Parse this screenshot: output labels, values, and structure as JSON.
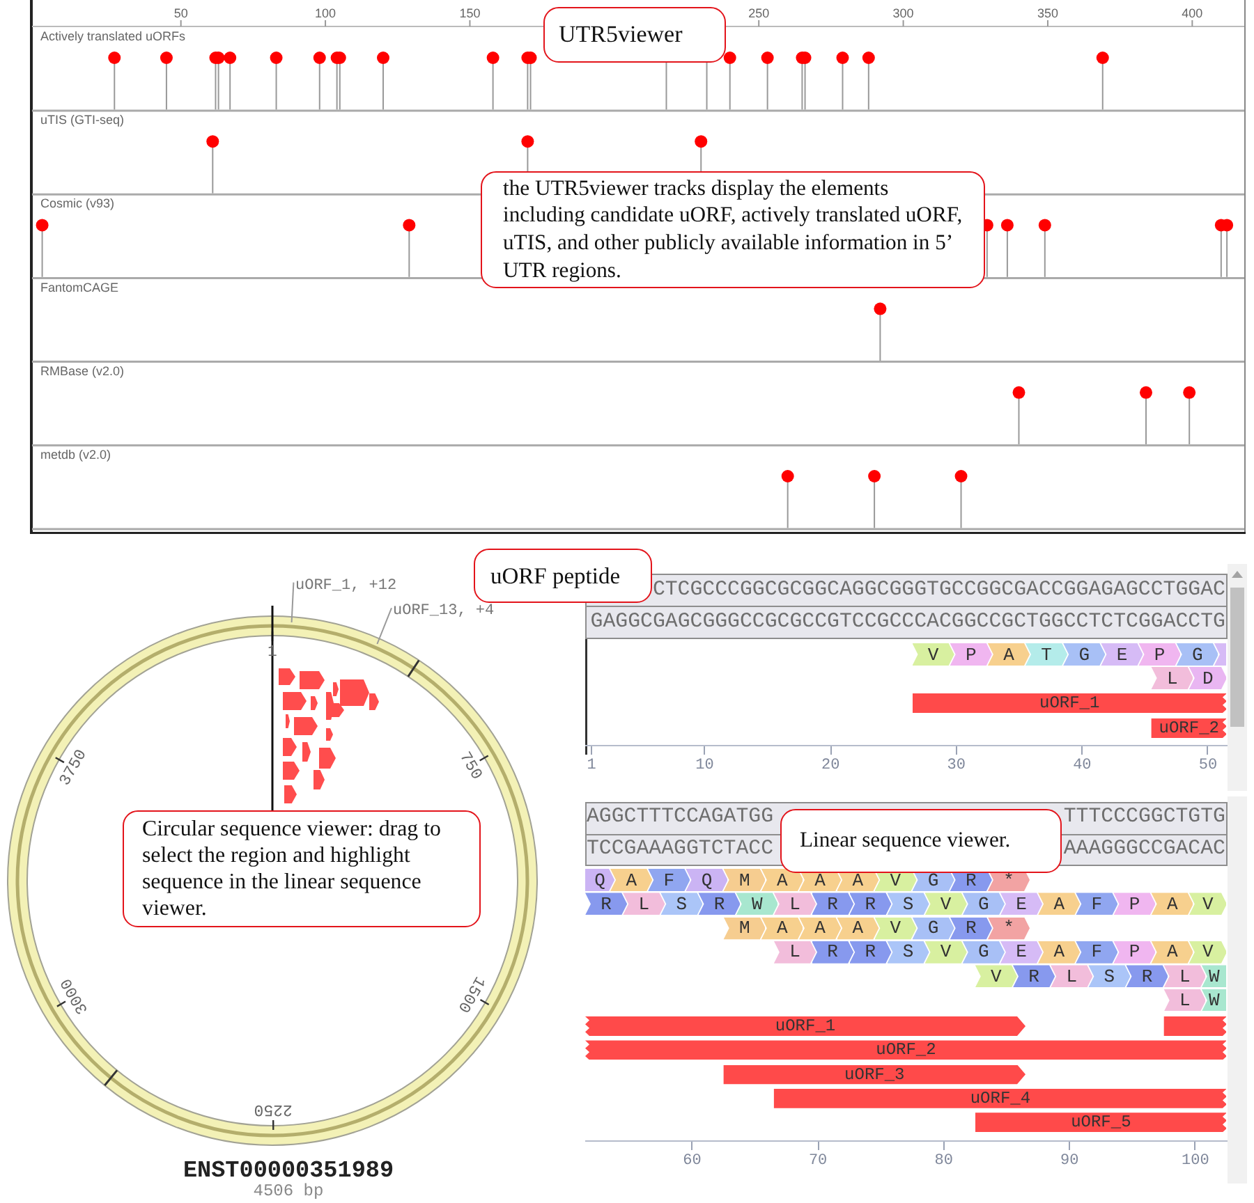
{
  "genome_tracks": {
    "ruler_ticks": [
      "50",
      "100",
      "150",
      "250",
      "300",
      "350",
      "400"
    ],
    "tracks": [
      {
        "label": "Actively translated uORFs"
      },
      {
        "label": "uTIS (GTI-seq)"
      },
      {
        "label": "Cosmic (v93)"
      },
      {
        "label": "FantomCAGE"
      },
      {
        "label": "RMBase (v2.0)"
      },
      {
        "label": "metdb (v2.0)"
      }
    ]
  },
  "circular_viewer": {
    "feature_labels": [
      "uORF_1, +12",
      "uORF_13, +4"
    ],
    "tick_labels": [
      "1",
      "750",
      "1500",
      "2250",
      "3000",
      "3750"
    ],
    "transcript_id": "ENST00000351989",
    "length": "4506 bp"
  },
  "linear_viewers": [
    {
      "strands": [
        {
          "fragments": [
            "CTCGCCCGGCGCGGCAGGCGGGTGCCGGCGACCGGAGAGCCTGGAC"
          ]
        },
        {
          "fragments": [
            "GAGGCGAGCGGGCCGCGCCGTCCGCCCACGGCCGCTGGCCTCTCGGACCTG"
          ]
        }
      ],
      "residue_rows": [
        {
          "residues": [
            {
              "aa": "V",
              "color": "#d8f0a0"
            },
            {
              "aa": "P",
              "color": "#f0b6f0"
            },
            {
              "aa": "A",
              "color": "#f7d08e"
            },
            {
              "aa": "T",
              "color": "#b4ecea"
            },
            {
              "aa": "G",
              "color": "#a8c0f6"
            },
            {
              "aa": "E",
              "color": "#d6bbf6"
            },
            {
              "aa": "P",
              "color": "#f0b6f0"
            },
            {
              "aa": "G",
              "color": "#a8c0f6"
            },
            {
              "color": "#d6bbf6"
            }
          ]
        },
        {
          "residues": [
            {
              "aa": "L",
              "color": "#f2bddb"
            },
            {
              "aa": "D",
              "color": "#e9b6f2"
            }
          ]
        }
      ],
      "features": [
        {
          "label": "uORF_1"
        },
        {
          "label": "uORF_2"
        }
      ],
      "axis_ticks": [
        "1",
        "10",
        "20",
        "30",
        "40",
        "50"
      ]
    },
    {
      "strands": [
        {
          "fragments": [
            "AGGCTTTCCAGATGG",
            "TTTCCCGGCTGTG"
          ]
        },
        {
          "fragments": [
            "TCCGAAAGGTCTACC",
            "AAAGGGCCGACAC"
          ]
        }
      ],
      "residue_rows": [
        {
          "residues": [
            {
              "aa": "Q",
              "color": "#cbb4f4"
            },
            {
              "aa": "A",
              "color": "#f7d08e"
            },
            {
              "aa": "F",
              "color": "#90a6f0"
            },
            {
              "aa": "Q",
              "color": "#cbb4f4"
            },
            {
              "aa": "M",
              "color": "#f6cd90"
            },
            {
              "aa": "A",
              "color": "#f7d08e"
            },
            {
              "aa": "A",
              "color": "#f7d08e"
            },
            {
              "aa": "A",
              "color": "#f7d08e"
            },
            {
              "aa": "V",
              "color": "#d8f0a0"
            },
            {
              "aa": "G",
              "color": "#a8c0f6"
            },
            {
              "aa": "R",
              "color": "#8799ee"
            },
            {
              "aa": "*",
              "color": "#f2a3a3"
            }
          ]
        },
        {
          "residues": [
            {
              "aa": "R",
              "color": "#8799ee"
            },
            {
              "aa": "L",
              "color": "#f2bddb"
            },
            {
              "aa": "S",
              "color": "#abc5f8"
            },
            {
              "aa": "R",
              "color": "#8799ee"
            },
            {
              "aa": "W",
              "color": "#a8e7cf"
            },
            {
              "aa": "L",
              "color": "#f2bddb"
            },
            {
              "aa": "R",
              "color": "#8799ee"
            },
            {
              "aa": "R",
              "color": "#8799ee"
            },
            {
              "aa": "S",
              "color": "#abc5f8"
            },
            {
              "aa": "V",
              "color": "#d8f0a0"
            },
            {
              "aa": "G",
              "color": "#a8c0f6"
            },
            {
              "aa": "E",
              "color": "#d6bbf6"
            },
            {
              "aa": "A",
              "color": "#f7d08e"
            },
            {
              "aa": "F",
              "color": "#90a6f0"
            },
            {
              "aa": "P",
              "color": "#f0b6f0"
            },
            {
              "aa": "A",
              "color": "#f7d08e"
            },
            {
              "aa": "V",
              "color": "#d8f0a0"
            }
          ]
        },
        {
          "residues": [
            {
              "aa": "M",
              "color": "#f6cd90"
            },
            {
              "aa": "A",
              "color": "#f7d08e"
            },
            {
              "aa": "A",
              "color": "#f7d08e"
            },
            {
              "aa": "A",
              "color": "#f7d08e"
            },
            {
              "aa": "V",
              "color": "#d8f0a0"
            },
            {
              "aa": "G",
              "color": "#a8c0f6"
            },
            {
              "aa": "R",
              "color": "#8799ee"
            },
            {
              "aa": "*",
              "color": "#f2a3a3"
            }
          ]
        },
        {
          "residues": [
            {
              "aa": "L",
              "color": "#f2bddb"
            },
            {
              "aa": "R",
              "color": "#8799ee"
            },
            {
              "aa": "R",
              "color": "#8799ee"
            },
            {
              "aa": "S",
              "color": "#abc5f8"
            },
            {
              "aa": "V",
              "color": "#d8f0a0"
            },
            {
              "aa": "G",
              "color": "#a8c0f6"
            },
            {
              "aa": "E",
              "color": "#d6bbf6"
            },
            {
              "aa": "A",
              "color": "#f7d08e"
            },
            {
              "aa": "F",
              "color": "#90a6f0"
            },
            {
              "aa": "P",
              "color": "#f0b6f0"
            },
            {
              "aa": "A",
              "color": "#f7d08e"
            },
            {
              "aa": "V",
              "color": "#d8f0a0"
            }
          ]
        },
        {
          "residues": [
            {
              "aa": "V",
              "color": "#d8f0a0"
            },
            {
              "aa": "R",
              "color": "#8799ee"
            },
            {
              "aa": "L",
              "color": "#f2bddb"
            },
            {
              "aa": "S",
              "color": "#abc5f8"
            },
            {
              "aa": "R",
              "color": "#8799ee"
            },
            {
              "aa": "L",
              "color": "#f2bddb"
            },
            {
              "aa": "W",
              "color": "#a8e7cf"
            }
          ]
        },
        {
          "residues": [
            {
              "aa": "L",
              "color": "#f2bddb"
            },
            {
              "aa": "W",
              "color": "#a8e7cf"
            }
          ]
        }
      ],
      "features": [
        {
          "label": "uORF_1"
        },
        {
          "label": "uORF_2"
        },
        {
          "label": "uORF_3"
        },
        {
          "label": "uORF_4"
        },
        {
          "label": "uORF_5"
        }
      ],
      "axis_ticks": [
        "60",
        "70",
        "80",
        "90",
        "100"
      ]
    }
  ],
  "callouts": [
    {
      "text": "UTR5viewer"
    },
    {
      "text": "the UTR5viewer tracks display the elements including candidate uORF, actively translated uORF, uTIS, and other publicly available information in 5’ UTR regions."
    },
    {
      "text": "uORF peptide"
    },
    {
      "text": "Circular sequence viewer: drag to select the region and highlight sequence in the linear sequence viewer."
    },
    {
      "text": "Linear sequence viewer."
    }
  ]
}
